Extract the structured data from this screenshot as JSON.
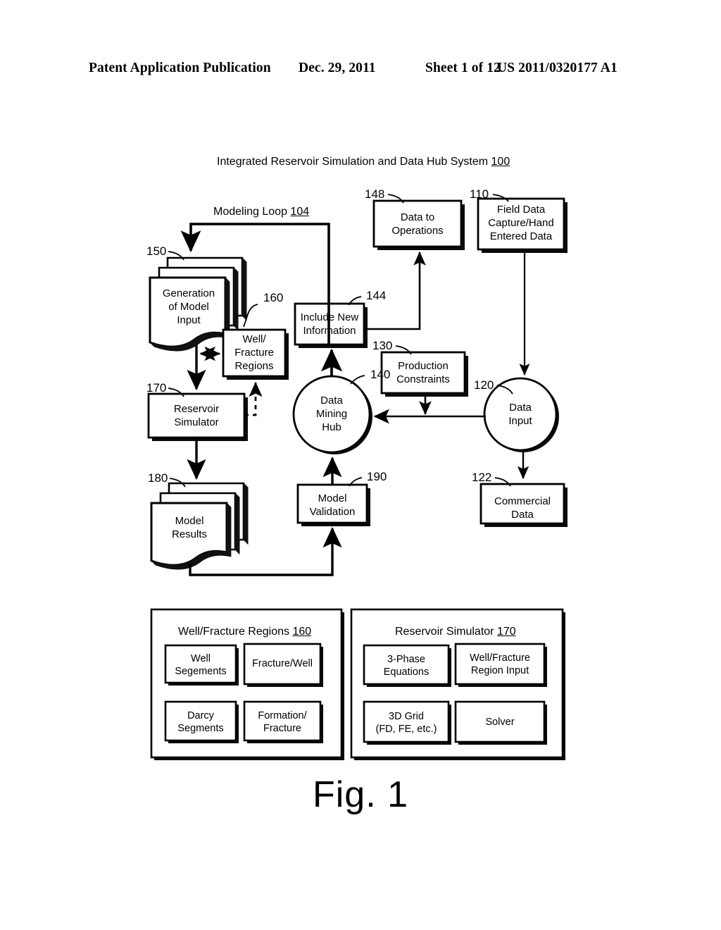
{
  "header": {
    "publication": "Patent Application Publication",
    "date": "Dec. 29, 2011",
    "sheet": "Sheet 1 of 12",
    "number": "US 2011/0320177 A1"
  },
  "figure": {
    "caption": "Fig. 1",
    "title_text": "Integrated Reservoir Simulation and Data Hub System ",
    "title_ref": "100",
    "loop_text": "Modeling Loop ",
    "loop_ref": "104"
  },
  "nodes": {
    "generation_of_model_input": {
      "label": "Generation\nof Model\nInput",
      "ref": "150"
    },
    "well_fracture_regions": {
      "label": "Well/\nFracture\nRegions",
      "ref": "160"
    },
    "reservoir_simulator": {
      "label": "Reservoir\nSimulator",
      "ref": "170"
    },
    "model_results": {
      "label": "Model\nResults",
      "ref": "180"
    },
    "include_new_information": {
      "label": "Include New\nInformation",
      "ref": "144"
    },
    "data_mining_hub": {
      "label": "Data\nMining\nHub",
      "ref": "140"
    },
    "model_validation": {
      "label": "Model\nValidation",
      "ref": "190"
    },
    "data_to_operations": {
      "label": "Data to\nOperations",
      "ref": "148"
    },
    "field_data_capture": {
      "label": "Field Data\nCapture/Hand\nEntered Data",
      "ref": "110"
    },
    "production_constraints": {
      "label": "Production\nConstraints",
      "ref": "130"
    },
    "data_input": {
      "label": "Data\nInput",
      "ref": "120"
    },
    "commercial_data": {
      "label": "Commercial\nData",
      "ref": "122"
    }
  },
  "detail_panels": [
    {
      "title_text": "Well/Fracture Regions ",
      "title_ref": "160",
      "cells": [
        {
          "label": "Well\nSegements"
        },
        {
          "label": "Fracture/Well"
        },
        {
          "label": "Darcy\nSegments"
        },
        {
          "label": "Formation/\nFracture"
        }
      ]
    },
    {
      "title_text": "Reservoir Simulator ",
      "title_ref": "170",
      "cells": [
        {
          "label": "3-Phase\nEquations"
        },
        {
          "label": "Well/Fracture\nRegion Input"
        },
        {
          "label": "3D Grid\n(FD, FE, etc.)"
        },
        {
          "label": "Solver"
        }
      ]
    }
  ],
  "colors": {
    "ink": "#000000",
    "paper": "#ffffff",
    "shadow": "#111111"
  }
}
